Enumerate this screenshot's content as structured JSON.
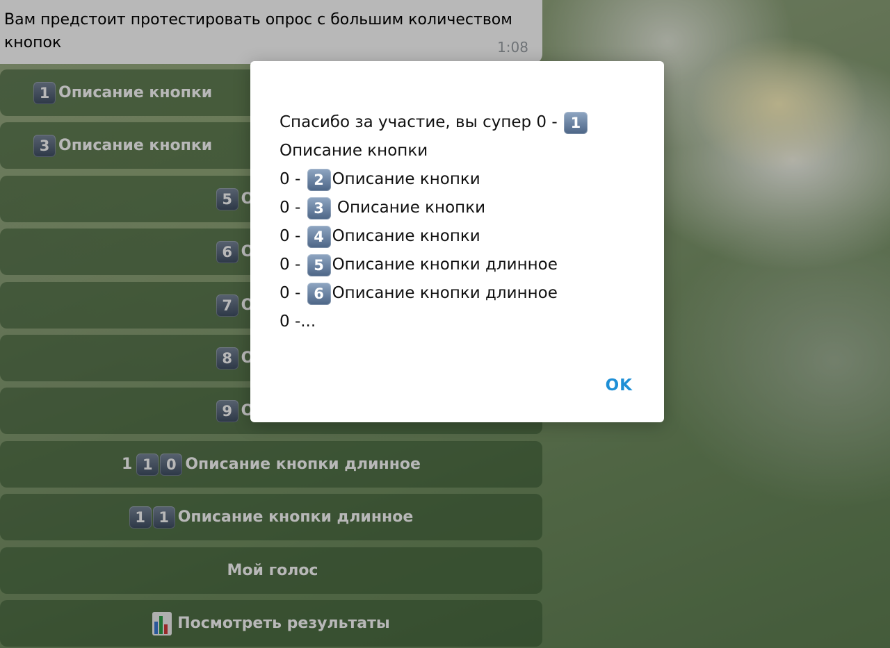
{
  "message": {
    "text": "Вам предстоит протестировать опрос с большим количеством кнопок",
    "time": "1:08"
  },
  "keyboard": [
    {
      "keys": [
        "1"
      ],
      "label": "Описание кнопки",
      "align": "left"
    },
    {
      "keys": [
        "3"
      ],
      "label": "Описание кнопки",
      "align": "left"
    },
    {
      "keys": [
        "5"
      ],
      "label": "Описание",
      "align": "center"
    },
    {
      "keys": [
        "6"
      ],
      "label": "Описание",
      "align": "center"
    },
    {
      "keys": [
        "7"
      ],
      "label": "Описание",
      "align": "center"
    },
    {
      "keys": [
        "8"
      ],
      "label": "Описание",
      "align": "center"
    },
    {
      "keys": [
        "9"
      ],
      "label": "Описание",
      "align": "center"
    },
    {
      "prefix": "1",
      "keys": [
        "1",
        "0"
      ],
      "label": "Описание кнопки длинное",
      "align": "center"
    },
    {
      "keys": [
        "1",
        "1"
      ],
      "label": "Описание кнопки длинное",
      "align": "center"
    },
    {
      "keys": [],
      "label": "Мой голос",
      "align": "center"
    },
    {
      "icon": "bar-chart-icon",
      "keys": [],
      "label": "Посмотреть результаты",
      "align": "center"
    }
  ],
  "dialog": {
    "lines": [
      {
        "text": "Спасибо за участие, вы супер 0 - ",
        "key": "1",
        "after": ""
      },
      {
        "text": "Описание кнопки",
        "key": "",
        "after": ""
      },
      {
        "text": "0 - ",
        "key": "2",
        "after": "Описание кнопки"
      },
      {
        "text": "0 - ",
        "key": "3",
        "after": " Описание кнопки"
      },
      {
        "text": "0 - ",
        "key": "4",
        "after": "Описание кнопки"
      },
      {
        "text": "0 - ",
        "key": "5",
        "after": "Описание кнопки длинное"
      },
      {
        "text": "0 - ",
        "key": "6",
        "after": "Описание кнопки длинное"
      },
      {
        "text": "0 -...",
        "key": "",
        "after": ""
      }
    ],
    "ok_label": "OK"
  },
  "colors": {
    "ok": "#1e8fd6",
    "keycap": "#5d7696"
  }
}
